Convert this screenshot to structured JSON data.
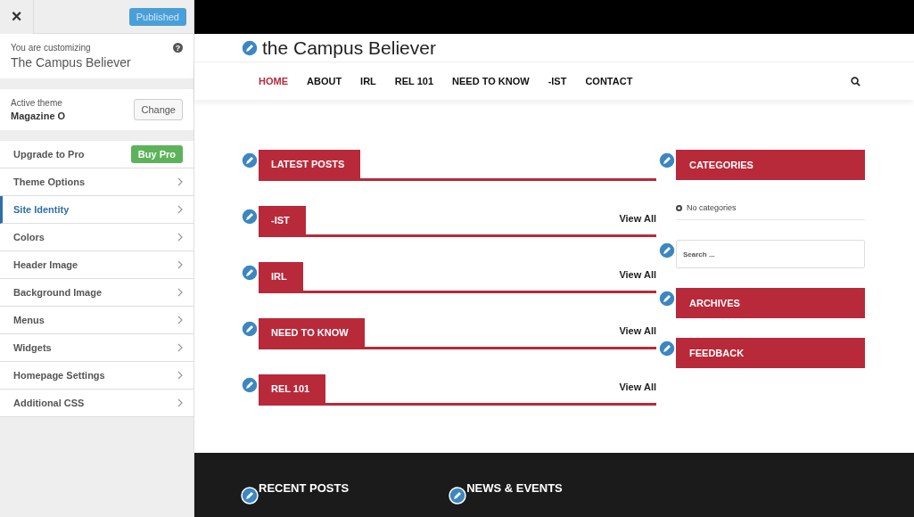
{
  "sidebar": {
    "close": "×",
    "publish_button": "Published",
    "customizing_label": "You are customizing",
    "site_name": "The Campus Believer",
    "help": "?",
    "theme_label": "Active theme",
    "theme_name": "Magazine O",
    "change_button": "Change",
    "upgrade": {
      "label": "Upgrade to Pro",
      "button": "Buy Pro"
    },
    "items": [
      {
        "label": "Theme Options",
        "selected": false
      },
      {
        "label": "Site Identity",
        "selected": true
      },
      {
        "label": "Colors",
        "selected": false
      },
      {
        "label": "Header Image",
        "selected": false
      },
      {
        "label": "Background Image",
        "selected": false
      },
      {
        "label": "Menus",
        "selected": false
      },
      {
        "label": "Widgets",
        "selected": false
      },
      {
        "label": "Homepage Settings",
        "selected": false
      },
      {
        "label": "Additional CSS",
        "selected": false
      }
    ]
  },
  "preview": {
    "logo": "the Campus Believer",
    "nav": [
      {
        "label": "HOME",
        "selected": true
      },
      {
        "label": "ABOUT",
        "selected": false
      },
      {
        "label": "IRL",
        "selected": false
      },
      {
        "label": "REL 101",
        "selected": false
      },
      {
        "label": "NEED TO KNOW",
        "selected": false
      },
      {
        "label": "-IST",
        "selected": false
      },
      {
        "label": "CONTACT",
        "selected": false
      }
    ],
    "sections": [
      {
        "title": "LATEST POSTS"
      },
      {
        "title": "-IST",
        "link": "View All"
      },
      {
        "title": "IRL",
        "link": "View All"
      },
      {
        "title": "NEED TO KNOW",
        "link": "View All"
      },
      {
        "title": "REL 101",
        "link": "View All"
      }
    ],
    "widgets": [
      {
        "kind": "heading",
        "title": "CATEGORIES"
      },
      {
        "kind": "list",
        "items": [
          "No categories"
        ]
      },
      {
        "kind": "search",
        "placeholder": "Search ..."
      },
      {
        "kind": "heading",
        "title": "ARCHIVES"
      },
      {
        "kind": "heading",
        "title": "FEEDBACK"
      }
    ],
    "footer": [
      "RECENT POSTS",
      "NEWS & EVENTS"
    ]
  }
}
